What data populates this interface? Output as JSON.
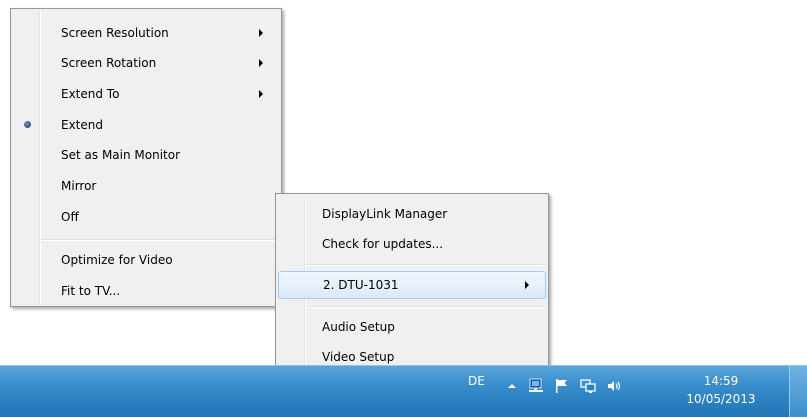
{
  "context_menu": {
    "items": [
      {
        "label": "Screen Resolution",
        "submenu": true
      },
      {
        "label": "Screen Rotation",
        "submenu": true
      },
      {
        "label": "Extend To",
        "submenu": true
      },
      {
        "label": "Extend",
        "selected": true
      },
      {
        "label": "Set as Main Monitor"
      },
      {
        "label": "Mirror"
      },
      {
        "label": "Off"
      },
      {
        "label": "Optimize for Video"
      },
      {
        "label": "Fit to TV..."
      }
    ]
  },
  "displaylink_menu": {
    "items": [
      {
        "label": "DisplayLink Manager"
      },
      {
        "label": "Check for updates..."
      },
      {
        "label": "2. DTU-1031",
        "submenu": true,
        "highlighted": true
      },
      {
        "label": "Audio Setup"
      },
      {
        "label": "Video Setup"
      }
    ]
  },
  "taskbar": {
    "language": "DE",
    "tray_icons": [
      "show-hidden-icons",
      "network-icon",
      "action-center-flag-icon",
      "displaylink-icon",
      "volume-icon"
    ],
    "clock": {
      "time": "14:59",
      "date": "10/05/2013"
    }
  },
  "colors": {
    "menu_background": "#f0f0f0",
    "highlight_border": "#a8c8ee",
    "taskbar": "#2a7fc0"
  }
}
